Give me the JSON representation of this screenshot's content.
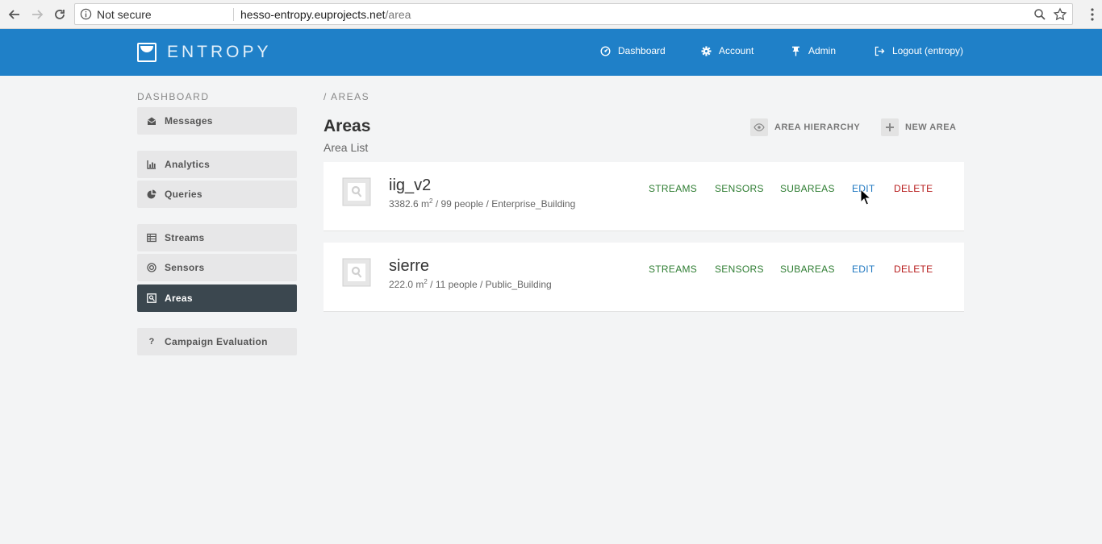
{
  "browser": {
    "security_label": "Not secure",
    "url_host": "hesso-entropy.euprojects.net",
    "url_path": "/area"
  },
  "header": {
    "logo_text": "ENTROPY",
    "nav": [
      {
        "label": "Dashboard",
        "icon": "dashboard-icon"
      },
      {
        "label": "Account",
        "icon": "gear-icon"
      },
      {
        "label": "Admin",
        "icon": "pin-icon"
      },
      {
        "label": "Logout (entropy)",
        "icon": "logout-icon"
      }
    ]
  },
  "sidebar": {
    "heading": "DASHBOARD",
    "items": [
      {
        "label": "Messages",
        "icon": "envelope-icon"
      },
      {
        "label": "Analytics",
        "icon": "bar-chart-icon"
      },
      {
        "label": "Queries",
        "icon": "pie-chart-icon"
      },
      {
        "label": "Streams",
        "icon": "table-icon"
      },
      {
        "label": "Sensors",
        "icon": "target-icon"
      },
      {
        "label": "Areas",
        "icon": "map-pin-square-icon",
        "active": true
      },
      {
        "label": "Campaign Evaluation",
        "icon": "question-icon",
        "icon_glyph": "?"
      }
    ]
  },
  "main": {
    "breadcrumb": "/ AREAS",
    "title": "Areas",
    "subtitle": "Area List",
    "actions": [
      {
        "label": "AREA HIERARCHY",
        "icon": "eye-icon"
      },
      {
        "label": "NEW AREA",
        "icon": "plus-icon"
      }
    ],
    "areas": [
      {
        "name": "iig_v2",
        "area": "3382.6 m",
        "area_sup": "2",
        "rest": " / 99 people / Enterprise_Building",
        "links": {
          "streams": "STREAMS",
          "sensors": "SENSORS",
          "subareas": "SUBAREAS",
          "edit": "EDIT",
          "delete": "DELETE"
        }
      },
      {
        "name": "sierre",
        "area": "222.0 m",
        "area_sup": "2",
        "rest": " / 11 people / Public_Building",
        "links": {
          "streams": "STREAMS",
          "sensors": "SENSORS",
          "subareas": "SUBAREAS",
          "edit": "EDIT",
          "delete": "DELETE"
        }
      }
    ]
  },
  "colors": {
    "header_blue": "#1f80c8",
    "sidebar_active": "#3b474f",
    "link_green": "#2e7d32",
    "link_blue": "#1f78c1",
    "link_red": "#b71c1c"
  }
}
